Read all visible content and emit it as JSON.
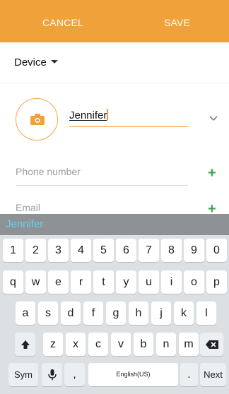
{
  "topbar": {
    "cancel": "CANCEL",
    "save": "SAVE",
    "color": "#f0a23a"
  },
  "device": {
    "label": "Device",
    "dropdown_icon": "caret-down-icon"
  },
  "contact": {
    "photo_icon": "camera-icon",
    "name_value": "Jennifer",
    "expand_icon": "chevron-down-icon",
    "phone_placeholder": "Phone number",
    "email_placeholder": "Email",
    "add_symbol": "+"
  },
  "suggestion": {
    "word": "Jennifer"
  },
  "keyboard": {
    "digits": [
      "1",
      "2",
      "3",
      "4",
      "5",
      "6",
      "7",
      "8",
      "9",
      "0"
    ],
    "row1": [
      "q",
      "w",
      "e",
      "r",
      "t",
      "y",
      "u",
      "i",
      "o",
      "p"
    ],
    "row2": [
      "a",
      "s",
      "d",
      "f",
      "g",
      "h",
      "j",
      "k",
      "l"
    ],
    "row3": [
      "z",
      "x",
      "c",
      "v",
      "b",
      "n",
      "m"
    ],
    "shift_icon": "shift-up-icon",
    "backspace_icon": "backspace-icon",
    "sym": "Sym",
    "mic_icon": "microphone-icon",
    "comma": ",",
    "space": "English(US)",
    "period": ".",
    "next": "Next"
  }
}
